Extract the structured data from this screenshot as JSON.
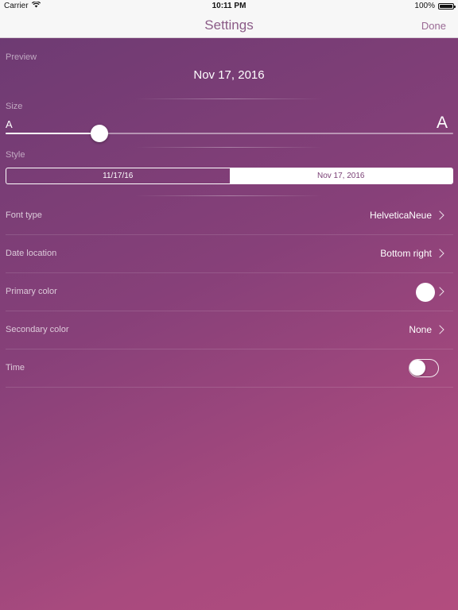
{
  "status_bar": {
    "carrier": "Carrier",
    "time": "10:11 PM",
    "battery": "100%"
  },
  "nav": {
    "title": "Settings",
    "done_label": "Done"
  },
  "preview": {
    "section_label": "Preview",
    "date": "Nov 17, 2016"
  },
  "size": {
    "section_label": "Size",
    "small_label": "A",
    "large_label": "A",
    "value_fraction": 0.21
  },
  "style": {
    "section_label": "Style",
    "options": [
      "11/17/16",
      "Nov 17, 2016"
    ],
    "selected_index": 1
  },
  "rows": {
    "font_type": {
      "label": "Font type",
      "value": "HelveticaNeue"
    },
    "date_location": {
      "label": "Date location",
      "value": "Bottom right"
    },
    "primary_color": {
      "label": "Primary color",
      "value_color": "#ffffff"
    },
    "secondary_color": {
      "label": "Secondary color",
      "value": "None"
    },
    "time": {
      "label": "Time",
      "enabled": false
    }
  },
  "colors": {
    "accent": "#8b5b87",
    "gradient_start": "#6b3a72",
    "gradient_end": "#b24c7e"
  },
  "icons": {
    "wifi": "wifi-icon",
    "battery": "battery-icon",
    "chevron": "chevron-right-icon"
  }
}
